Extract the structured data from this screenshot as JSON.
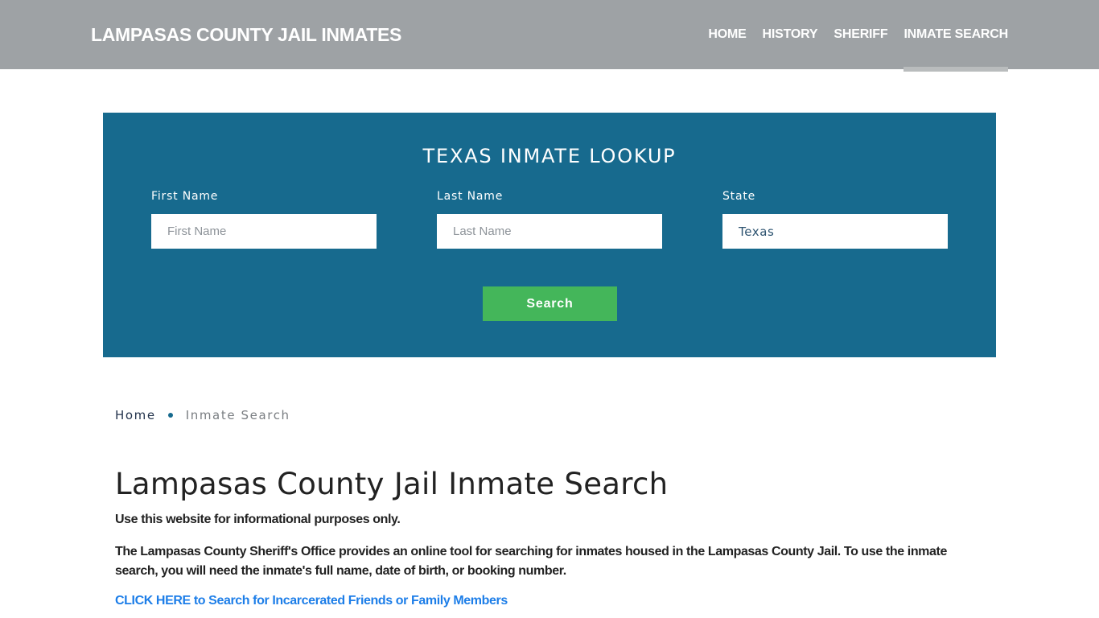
{
  "header": {
    "brand": "LAMPASAS COUNTY JAIL INMATES",
    "nav": [
      {
        "label": "HOME",
        "active": false
      },
      {
        "label": "HISTORY",
        "active": false
      },
      {
        "label": "SHERIFF",
        "active": false
      },
      {
        "label": "INMATE SEARCH",
        "active": true
      }
    ]
  },
  "lookup": {
    "title": "TEXAS INMATE LOOKUP",
    "first_name": {
      "label": "First Name",
      "placeholder": "First Name",
      "value": ""
    },
    "last_name": {
      "label": "Last Name",
      "placeholder": "Last Name",
      "value": ""
    },
    "state": {
      "label": "State",
      "value": "Texas"
    },
    "search_label": "Search"
  },
  "breadcrumb": {
    "home": "Home",
    "current": "Inmate Search"
  },
  "main": {
    "title": "Lampasas County Jail Inmate Search",
    "notice": "Use this website for informational purposes only.",
    "description": "The Lampasas County Sheriff's Office provides an online tool for searching for inmates housed in the Lampasas County Jail. To use the inmate search, you will need the inmate's full name, date of birth, or booking number.",
    "cta_link": "CLICK HERE to Search for Incarcerated Friends or Family Members"
  },
  "colors": {
    "header_bg": "#9ea2a5",
    "lookup_bg": "#176a8e",
    "search_button": "#44b65a",
    "link": "#1d7ee8"
  }
}
